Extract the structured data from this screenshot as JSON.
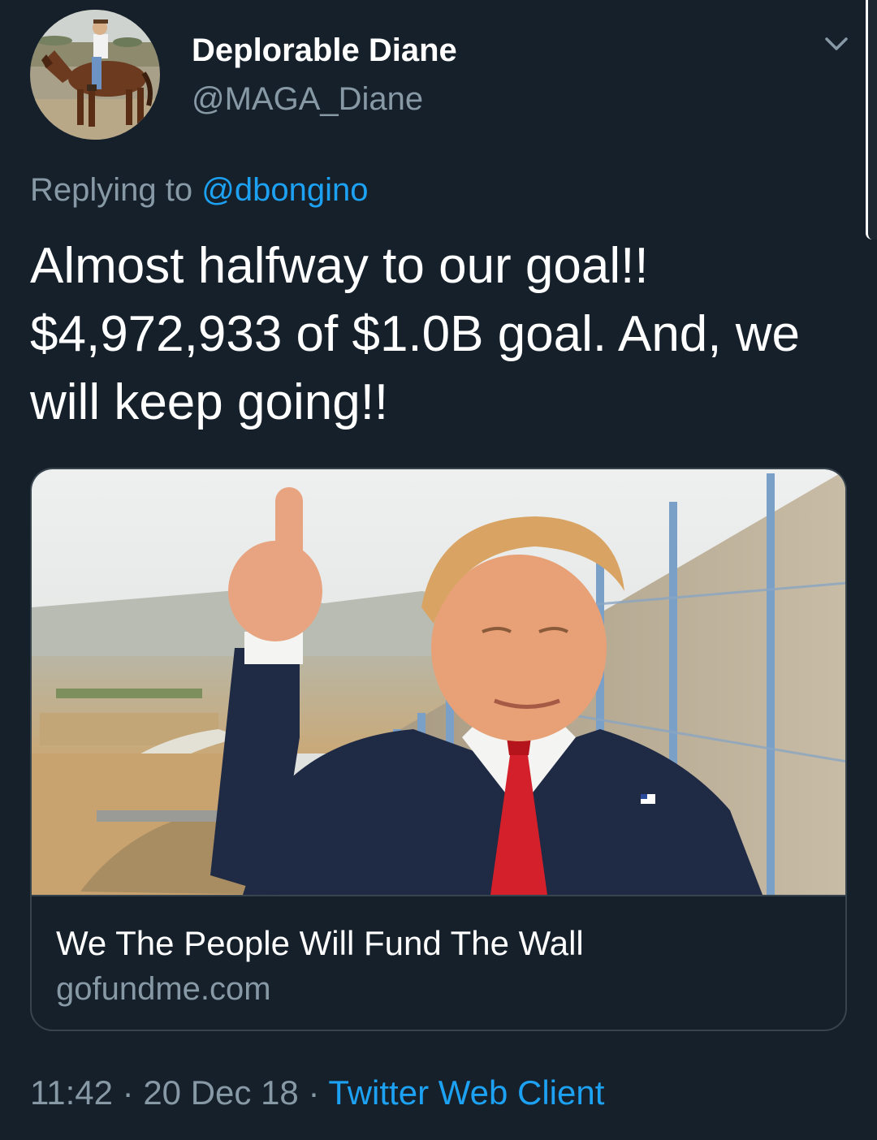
{
  "user": {
    "display_name": "Deplorable Diane",
    "handle": "@MAGA_Diane",
    "avatar_icon": "avatar-horse-rider"
  },
  "reply": {
    "prefix": "Replying to ",
    "mention": "@dbongino"
  },
  "tweet": {
    "lines": [
      "Almost halfway to our goal!!",
      "$4,972,933 of $1.0B goal.  And, we",
      "will keep going!!"
    ]
  },
  "link_card": {
    "title": "We The People Will Fund The Wall",
    "domain": "gofundme.com",
    "image_icon": "thumbs-up-man-border-wall-photo"
  },
  "meta": {
    "time": "11:42",
    "separator": " · ",
    "date": "20 Dec 18",
    "source": "Twitter Web Client"
  },
  "colors": {
    "background": "#15202b",
    "text": "#ffffff",
    "secondary_text": "#8899a6",
    "link": "#1da1f2",
    "border": "#38444d"
  }
}
